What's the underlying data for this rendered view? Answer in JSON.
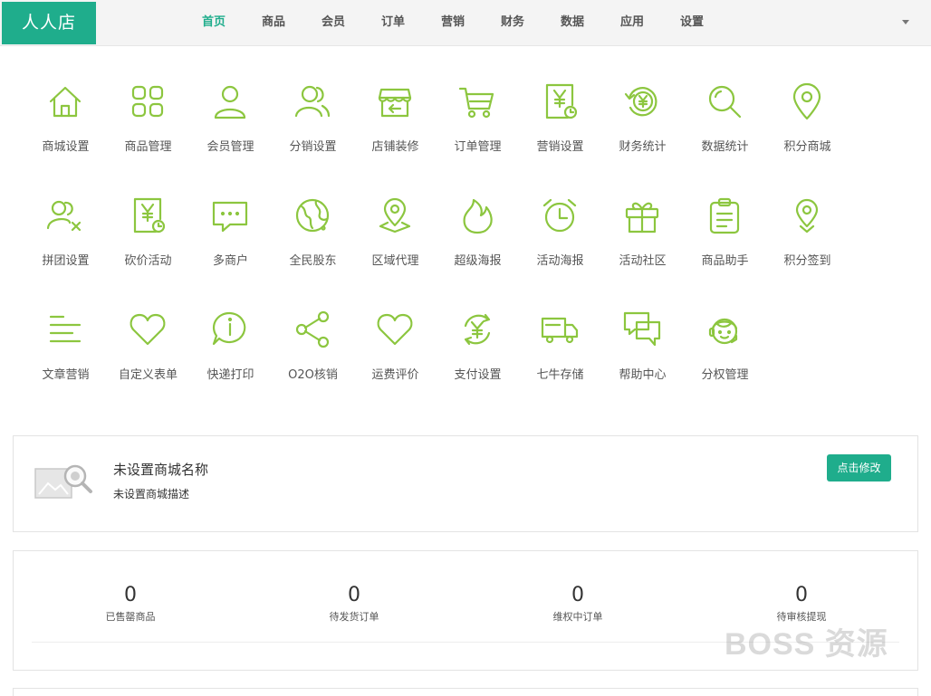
{
  "logo": "人人店",
  "nav": [
    {
      "label": "首页",
      "active": true
    },
    {
      "label": "商品"
    },
    {
      "label": "会员"
    },
    {
      "label": "订单"
    },
    {
      "label": "营销"
    },
    {
      "label": "财务"
    },
    {
      "label": "数据"
    },
    {
      "label": "应用"
    },
    {
      "label": "设置"
    }
  ],
  "accent_color": "#1fad8c",
  "icon_color": "#8cc63f",
  "apps": [
    {
      "label": "商城设置",
      "icon": "home-icon"
    },
    {
      "label": "商品管理",
      "icon": "grid-icon"
    },
    {
      "label": "会员管理",
      "icon": "user-icon"
    },
    {
      "label": "分销设置",
      "icon": "users-icon"
    },
    {
      "label": "店铺装修",
      "icon": "shop-icon"
    },
    {
      "label": "订单管理",
      "icon": "cart-icon"
    },
    {
      "label": "营销设置",
      "icon": "yen-doc-icon"
    },
    {
      "label": "财务统计",
      "icon": "yen-refresh-icon"
    },
    {
      "label": "数据统计",
      "icon": "search-icon"
    },
    {
      "label": "积分商城",
      "icon": "location-icon"
    },
    {
      "label": "拼团设置",
      "icon": "group-icon"
    },
    {
      "label": "砍价活动",
      "icon": "yen-doc-clock-icon"
    },
    {
      "label": "多商户",
      "icon": "chat-icon"
    },
    {
      "label": "全民股东",
      "icon": "globe-icon"
    },
    {
      "label": "区域代理",
      "icon": "map-pin-icon"
    },
    {
      "label": "超级海报",
      "icon": "flame-icon"
    },
    {
      "label": "活动海报",
      "icon": "alarm-icon"
    },
    {
      "label": "活动社区",
      "icon": "gift-icon"
    },
    {
      "label": "商品助手",
      "icon": "clipboard-icon"
    },
    {
      "label": "积分签到",
      "icon": "pin-icon"
    },
    {
      "label": "文章营销",
      "icon": "text-lines-icon"
    },
    {
      "label": "自定义表单",
      "icon": "heart-icon"
    },
    {
      "label": "快递打印",
      "icon": "info-bubble-icon"
    },
    {
      "label": "O2O核销",
      "icon": "share-icon"
    },
    {
      "label": "运费评价",
      "icon": "heart-outline-icon"
    },
    {
      "label": "支付设置",
      "icon": "yen-cycle-icon"
    },
    {
      "label": "七牛存储",
      "icon": "truck-icon"
    },
    {
      "label": "帮助中心",
      "icon": "chat-double-icon"
    },
    {
      "label": "分权管理",
      "icon": "service-icon"
    }
  ],
  "store": {
    "name": "未设置商城名称",
    "description": "未设置商城描述",
    "edit_button": "点击修改"
  },
  "stats": [
    {
      "value": "0",
      "label": "已售罄商品"
    },
    {
      "value": "0",
      "label": "待发货订单"
    },
    {
      "value": "0",
      "label": "维权中订单"
    },
    {
      "value": "0",
      "label": "待审核提现"
    }
  ],
  "watermark": "BOSS 资源"
}
